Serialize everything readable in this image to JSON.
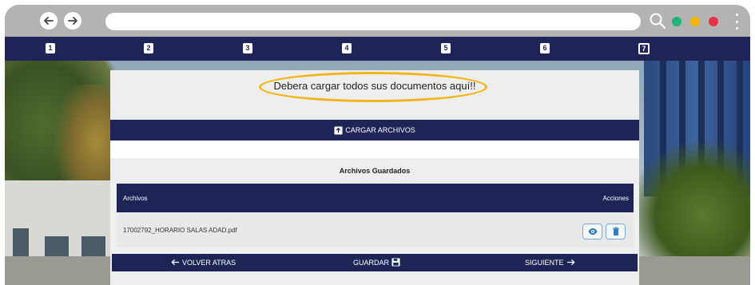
{
  "browser": {
    "back_icon": "arrow-left-icon",
    "forward_icon": "arrow-right-icon",
    "search_icon": "search-icon",
    "dots": [
      "#21b573",
      "#f7b500",
      "#e63244"
    ]
  },
  "steps": [
    {
      "label": "1"
    },
    {
      "label": "2"
    },
    {
      "label": "3"
    },
    {
      "label": "4"
    },
    {
      "label": "5"
    },
    {
      "label": "6"
    },
    {
      "label": "7"
    }
  ],
  "notice": {
    "text": "Debera cargar todos sus documentos aquí!!",
    "highlight_color": "#f2b517"
  },
  "upload": {
    "label": "CARGAR ARCHIVOS",
    "icon": "upload-icon"
  },
  "saved": {
    "title": "Archivos Guardados"
  },
  "table": {
    "headers": {
      "files": "Archivos",
      "actions": "Acciones"
    },
    "rows": [
      {
        "file": "17002792_HORARIO SALAS ADAD.pdf"
      }
    ]
  },
  "footer": {
    "back_label": "VOLVER ATRAS",
    "save_label": "GUARDAR",
    "next_label": "SIGUIENTE"
  },
  "colors": {
    "navy": "#1f2456",
    "accent_blue": "#2f7ec1",
    "highlight": "#f2b517"
  }
}
